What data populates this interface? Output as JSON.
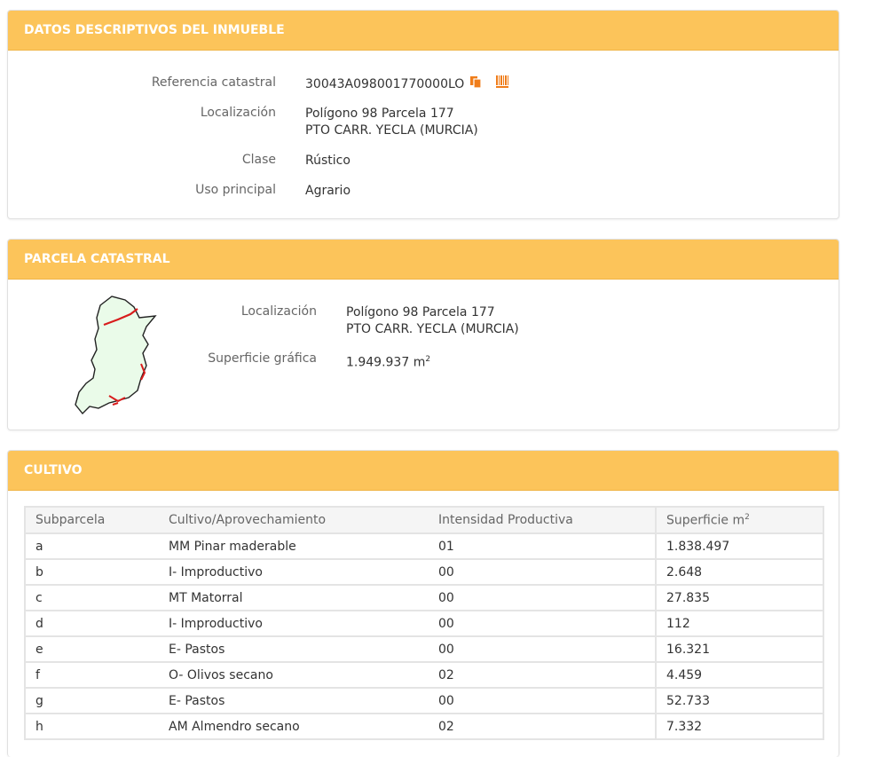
{
  "section1": {
    "title": "DATOS DESCRIPTIVOS DEL INMUEBLE",
    "ref_label": "Referencia catastral",
    "ref_value": "30043A098001770000LO",
    "loc_label": "Localización",
    "loc_line1": "Polígono 98 Parcela 177",
    "loc_line2": "PTO CARR. YECLA (MURCIA)",
    "clase_label": "Clase",
    "clase_value": "Rústico",
    "uso_label": "Uso principal",
    "uso_value": "Agrario"
  },
  "section2": {
    "title": "PARCELA CATASTRAL",
    "loc_label": "Localización",
    "loc_line1": "Polígono 98 Parcela 177",
    "loc_line2": "PTO CARR. YECLA (MURCIA)",
    "sup_label": "Superficie gráfica",
    "sup_value": "1.949.937 m",
    "sup_unit_exp": "2"
  },
  "section3": {
    "title": "CULTIVO",
    "headers": [
      "Subparcela",
      "Cultivo/Aprovechamiento",
      "Intensidad Productiva",
      "Superficie m"
    ],
    "header_exp": "2",
    "rows": [
      [
        "a",
        "MM Pinar maderable",
        "01",
        "1.838.497"
      ],
      [
        "b",
        "I- Improductivo",
        "00",
        "2.648"
      ],
      [
        "c",
        "MT Matorral",
        "00",
        "27.835"
      ],
      [
        "d",
        "I- Improductivo",
        "00",
        "112"
      ],
      [
        "e",
        "E- Pastos",
        "00",
        "16.321"
      ],
      [
        "f",
        "O- Olivos secano",
        "02",
        "4.459"
      ],
      [
        "g",
        "E- Pastos",
        "00",
        "52.733"
      ],
      [
        "h",
        "AM Almendro secano",
        "02",
        "7.332"
      ]
    ]
  },
  "colors": {
    "header_bg": "#fcc45a",
    "icon_orange": "#f07d1a",
    "parcel_fill": "#eafbe9",
    "parcel_red": "#d81c1c"
  },
  "icons": [
    "copy-icon",
    "barcode-icon"
  ]
}
